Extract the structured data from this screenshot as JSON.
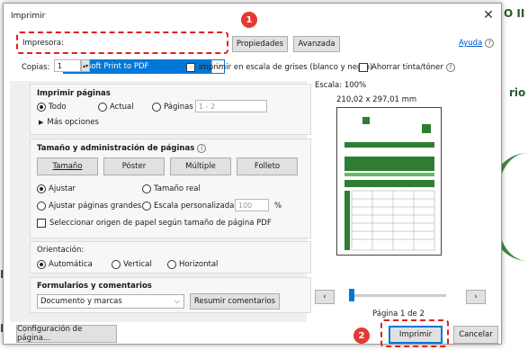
{
  "background": {
    "text_top_right": "O II",
    "text_right": "rio",
    "text_left1": "IF",
    "text_left2": "D"
  },
  "dialog": {
    "title": "Imprimir",
    "printer_label": "Impresora:",
    "printer_value": "Microsoft Print to PDF",
    "properties_btn": "Propiedades",
    "advanced_btn": "Avanzada",
    "help_link": "Ayuda",
    "copies_label": "Copias:",
    "copies_value": "1",
    "grayscale_label": "Imprimir en escala de grises (blanco y negro)",
    "save_ink_label": "Ahorrar tinta/tóner",
    "print_pages": {
      "heading": "Imprimir páginas",
      "all": "Todo",
      "current": "Actual",
      "pages": "Páginas",
      "range_placeholder": "1 - 2",
      "more_options": "Más opciones"
    },
    "size": {
      "heading": "Tamaño y administración de páginas",
      "tabs": [
        "Tamaño",
        "Póster",
        "Múltiple",
        "Folleto"
      ],
      "fit": "Ajustar",
      "real_size": "Tamaño real",
      "shrink_large": "Ajustar páginas grandes",
      "custom_scale": "Escala personalizada:",
      "scale_value": "100",
      "percent": "%",
      "paper_source": "Seleccionar origen de papel según tamaño de página PDF"
    },
    "orientation": {
      "heading": "Orientación:",
      "auto": "Automática",
      "vertical": "Vertical",
      "horizontal": "Horizontal"
    },
    "forms": {
      "heading": "Formularios y comentarios",
      "value": "Documento y marcas",
      "summarize_btn": "Resumir comentarios"
    },
    "preview": {
      "scale": "Escala: 100%",
      "dimensions": "210,02 x 297,01 mm",
      "page_indicator": "Página 1 de 2"
    },
    "page_setup_btn": "Configuración de página...",
    "print_btn": "Imprimir",
    "cancel_btn": "Cancelar",
    "badge1": "1",
    "badge2": "2"
  }
}
